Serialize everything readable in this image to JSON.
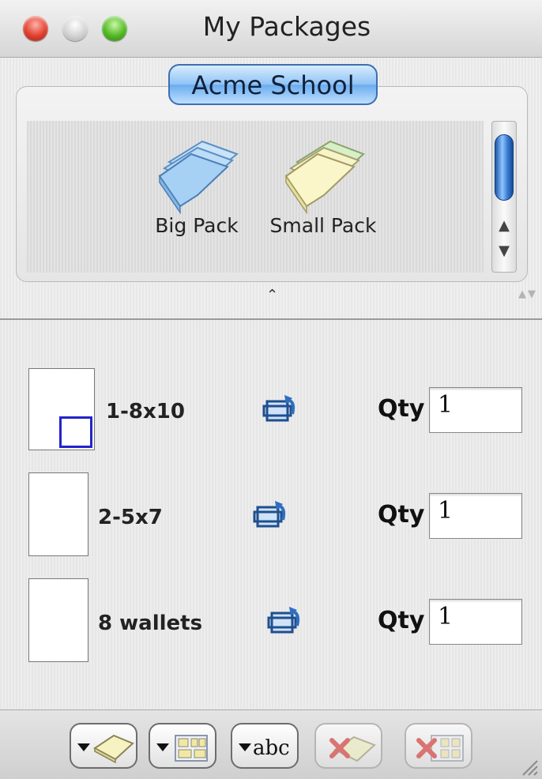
{
  "window": {
    "title": "My Packages"
  },
  "group": {
    "tab_label": "Acme School"
  },
  "packages": [
    {
      "label": "Big Pack",
      "icon": "big-pack-icon",
      "color": "#9cc8f2"
    },
    {
      "label": "Small Pack",
      "icon": "small-pack-icon",
      "color": "#f4f0b6"
    }
  ],
  "rows": [
    {
      "label": "1-8x10",
      "qty_label": "Qty",
      "qty": "1",
      "selected": true
    },
    {
      "label": "2-5x7",
      "qty_label": "Qty",
      "qty": "1",
      "selected": false
    },
    {
      "label": "8 wallets",
      "qty_label": "Qty",
      "qty": "1",
      "selected": false
    }
  ],
  "toolbar": {
    "buttons": [
      {
        "icon": "add-package-menu-icon",
        "enabled": true
      },
      {
        "icon": "add-layout-menu-icon",
        "enabled": true
      },
      {
        "icon": "add-text-menu-icon",
        "text": "abc",
        "enabled": true
      },
      {
        "icon": "delete-package-icon",
        "enabled": false
      },
      {
        "icon": "delete-layout-icon",
        "enabled": false
      }
    ]
  },
  "colors": {
    "accent": "#3d6fb2",
    "selection": "#2323cc",
    "delete": "#d9534f"
  }
}
